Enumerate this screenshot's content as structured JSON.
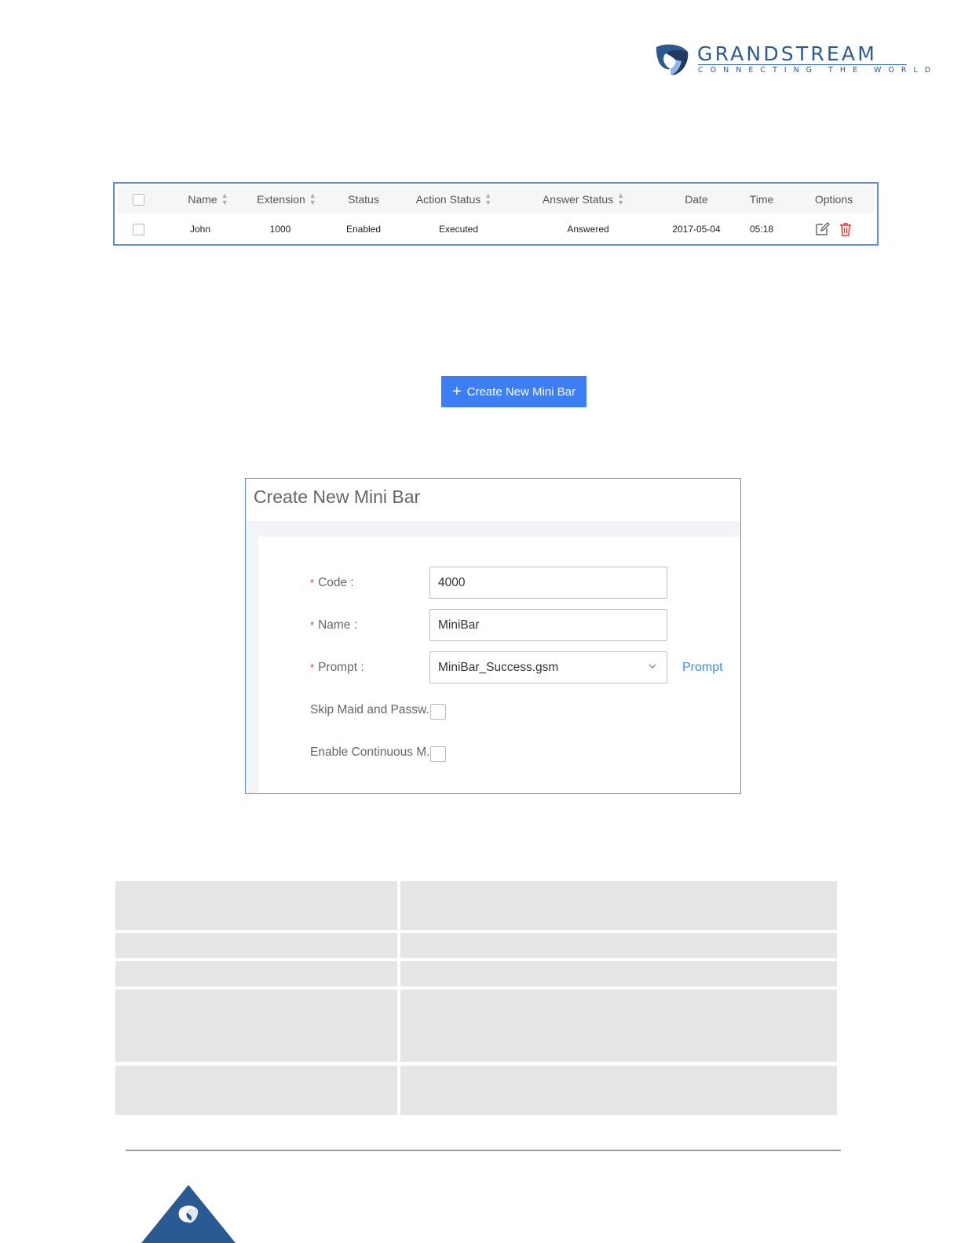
{
  "brand": {
    "name": "GRANDSTREAM",
    "tagline": "CONNECTING THE WORLD",
    "color": "#2a5a93"
  },
  "record_table": {
    "columns": [
      "Name",
      "Extension",
      "Status",
      "Action Status",
      "Answer Status",
      "Date",
      "Time",
      "Options"
    ],
    "rows": [
      {
        "name": "John",
        "extension": "1000",
        "status": "Enabled",
        "action_status": "Executed",
        "answer_status": "Answered",
        "date": "2017-05-04",
        "time": "05:18"
      }
    ],
    "icons": {
      "edit": "edit-icon",
      "delete": "trash-icon"
    },
    "delete_color": "#e53935"
  },
  "create_button": {
    "label": "Create New Mini Bar",
    "icon": "plus-icon",
    "color": "#3e7ef5"
  },
  "dialog": {
    "title": "Create New Mini Bar",
    "fields": {
      "code": {
        "label": "Code :",
        "value": "4000",
        "required": true
      },
      "name": {
        "label": "Name :",
        "value": "MiniBar",
        "required": true
      },
      "prompt": {
        "label": "Prompt :",
        "value": "MiniBar_Success.gsm",
        "required": true,
        "link": "Prompt"
      },
      "skip_maid": {
        "label": "Skip Maid and Passw...",
        "checked": false
      },
      "continuous": {
        "label": "Enable Continuous M...",
        "checked": false
      }
    },
    "required_marker": "*"
  },
  "footer": {
    "logo": "grandstream-logo-icon"
  }
}
